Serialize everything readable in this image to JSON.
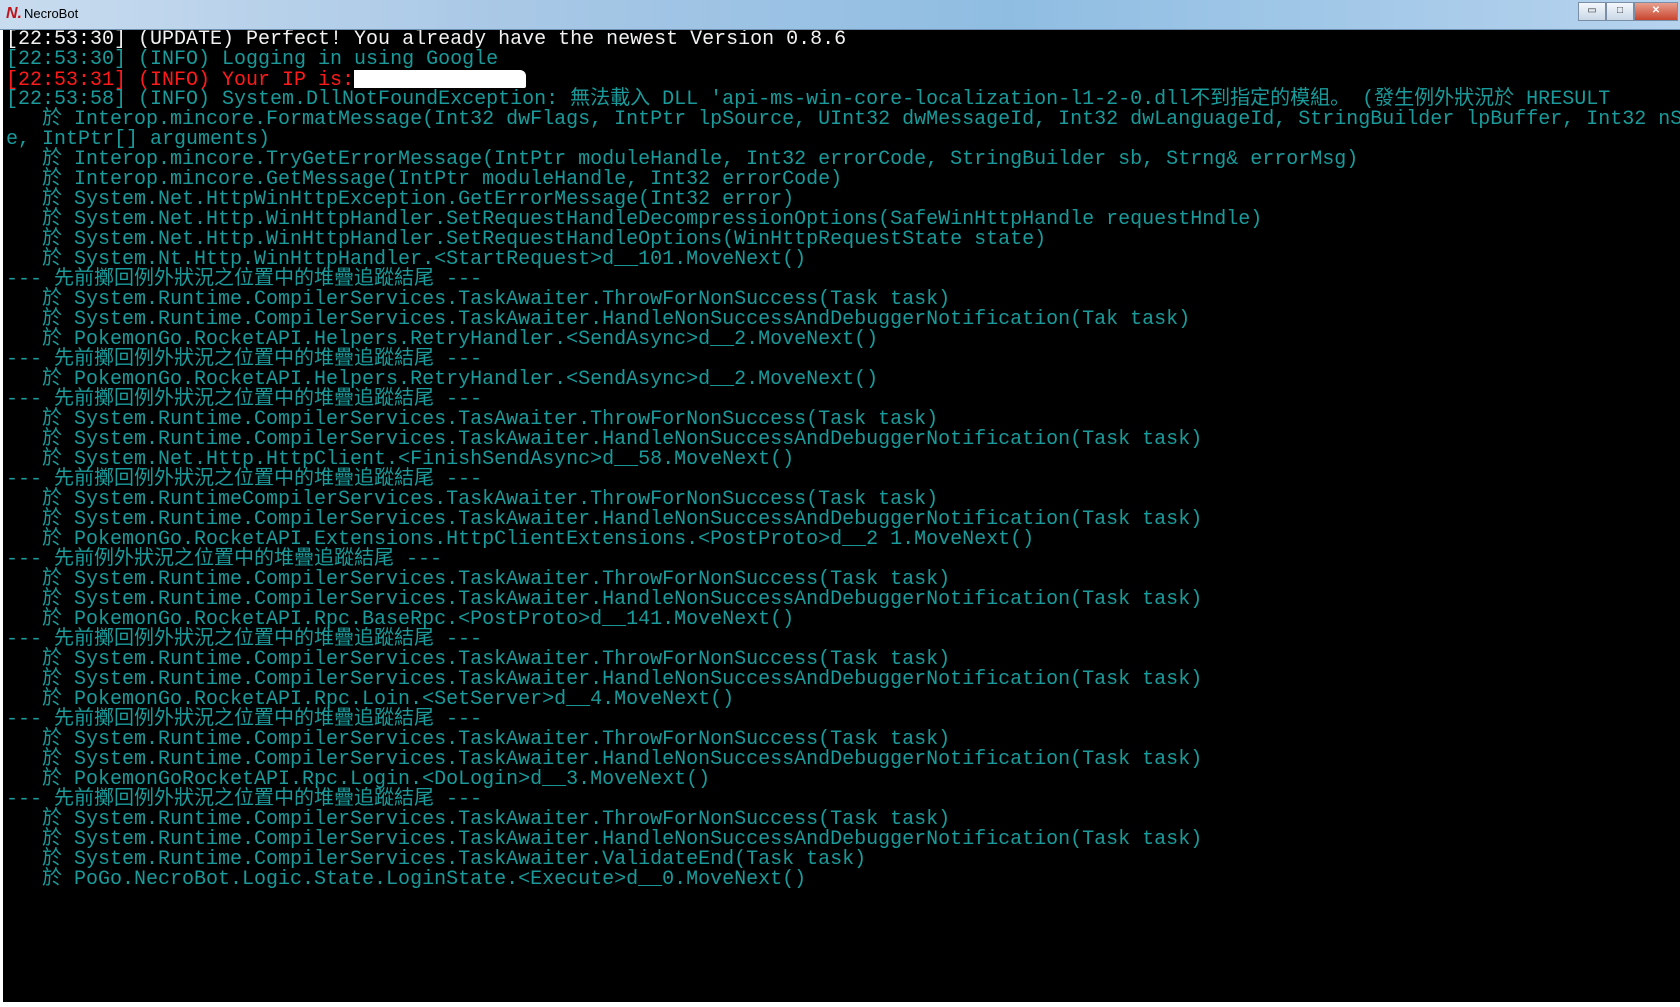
{
  "window": {
    "title": "NecroBot",
    "logo_text": "N.",
    "buttons": {
      "minimize": "▭",
      "maximize": "□",
      "close": "✕"
    }
  },
  "colors": {
    "white": "#f2f2f2",
    "teal": "#1a9a9a",
    "red": "#ff1a1a"
  },
  "lines": [
    {
      "color": "white",
      "text": "[22:53:30] (UPDATE) Perfect! You already have the newest Version 0.8.6"
    },
    {
      "color": "teal",
      "text": "[22:53:30] (INFO) Logging in using Google"
    },
    {
      "color": "red",
      "text": "[22:53:31] (INFO) Your IP is:",
      "redacted": true
    },
    {
      "color": "teal",
      "text": "[22:53:58] (INFO) System.DllNotFoundException: 無法載入 DLL 'api-ms-win-core-localization-l1-2-0.dll不到指定的模組。 (發生例外狀況於 HRESULT"
    },
    {
      "color": "teal",
      "text": "   於 Interop.mincore.FormatMessage(Int32 dwFlags, IntPtr lpSource, UInt32 dwMessageId, Int32 dwLanguageId, StringBuilder lpBuffer, Int32 nS"
    },
    {
      "color": "teal",
      "text": "e, IntPtr[] arguments)"
    },
    {
      "color": "teal",
      "text": "   於 Interop.mincore.TryGetErrorMessage(IntPtr moduleHandle, Int32 errorCode, StringBuilder sb, Strng& errorMsg)"
    },
    {
      "color": "teal",
      "text": "   於 Interop.mincore.GetMessage(IntPtr moduleHandle, Int32 errorCode)"
    },
    {
      "color": "teal",
      "text": "   於 System.Net.HttpWinHttpException.GetErrorMessage(Int32 error)"
    },
    {
      "color": "teal",
      "text": "   於 System.Net.Http.WinHttpHandler.SetRequestHandleDecompressionOptions(SafeWinHttpHandle requestHndle)"
    },
    {
      "color": "teal",
      "text": "   於 System.Net.Http.WinHttpHandler.SetRequestHandleOptions(WinHttpRequestState state)"
    },
    {
      "color": "teal",
      "text": "   於 System.Nt.Http.WinHttpHandler.<StartRequest>d__101.MoveNext()"
    },
    {
      "color": "teal",
      "text": "--- 先前擲回例外狀況之位置中的堆疊追蹤結尾 ---"
    },
    {
      "color": "teal",
      "text": "   於 System.Runtime.CompilerServices.TaskAwaiter.ThrowForNonSuccess(Task task)"
    },
    {
      "color": "teal",
      "text": "   於 System.Runtime.CompilerServices.TaskAwaiter.HandleNonSuccessAndDebuggerNotification(Tak task)"
    },
    {
      "color": "teal",
      "text": "   於 PokemonGo.RocketAPI.Helpers.RetryHandler.<SendAsync>d__2.MoveNext()"
    },
    {
      "color": "teal",
      "text": "--- 先前擲回例外狀況之位置中的堆疊追蹤結尾 ---"
    },
    {
      "color": "teal",
      "text": "   於 PokemonGo.RocketAPI.Helpers.RetryHandler.<SendAsync>d__2.MoveNext()"
    },
    {
      "color": "teal",
      "text": "--- 先前擲回例外狀況之位置中的堆疊追蹤結尾 ---"
    },
    {
      "color": "teal",
      "text": "   於 System.Runtime.CompilerServices.TasAwaiter.ThrowForNonSuccess(Task task)"
    },
    {
      "color": "teal",
      "text": "   於 System.Runtime.CompilerServices.TaskAwaiter.HandleNonSuccessAndDebuggerNotification(Task task)"
    },
    {
      "color": "teal",
      "text": "   於 System.Net.Http.HttpClient.<FinishSendAsync>d__58.MoveNext()"
    },
    {
      "color": "teal",
      "text": "--- 先前擲回例外狀況之位置中的堆疊追蹤結尾 ---"
    },
    {
      "color": "teal",
      "text": "   於 System.RuntimeCompilerServices.TaskAwaiter.ThrowForNonSuccess(Task task)"
    },
    {
      "color": "teal",
      "text": "   於 System.Runtime.CompilerServices.TaskAwaiter.HandleNonSuccessAndDebuggerNotification(Task task)"
    },
    {
      "color": "teal",
      "text": "   於 PokemonGo.RocketAPI.Extensions.HttpClientExtensions.<PostProto>d__2 1.MoveNext()"
    },
    {
      "color": "teal",
      "text": "--- 先前例外狀況之位置中的堆疊追蹤結尾 ---"
    },
    {
      "color": "teal",
      "text": "   於 System.Runtime.CompilerServices.TaskAwaiter.ThrowForNonSuccess(Task task)"
    },
    {
      "color": "teal",
      "text": "   於 System.Runtime.CompilerServices.TaskAwaiter.HandleNonSuccessAndDebuggerNotification(Task task)"
    },
    {
      "color": "teal",
      "text": "   於 PokemonGo.RocketAPI.Rpc.BaseRpc.<PostProto>d__141.MoveNext()"
    },
    {
      "color": "teal",
      "text": "--- 先前擲回例外狀況之位置中的堆疊追蹤結尾 ---"
    },
    {
      "color": "teal",
      "text": "   於 System.Runtime.CompilerServices.TaskAwaiter.ThrowForNonSuccess(Task task)"
    },
    {
      "color": "teal",
      "text": "   於 System.Runtime.CompilerServices.TaskAwaiter.HandleNonSuccessAndDebuggerNotification(Task task)"
    },
    {
      "color": "teal",
      "text": "   於 PokemonGo.RocketAPI.Rpc.Loin.<SetServer>d__4.MoveNext()"
    },
    {
      "color": "teal",
      "text": "--- 先前擲回例外狀況之位置中的堆疊追蹤結尾 ---"
    },
    {
      "color": "teal",
      "text": "   於 System.Runtime.CompilerServices.TaskAwaiter.ThrowForNonSuccess(Task task)"
    },
    {
      "color": "teal",
      "text": "   於 System.Runtime.CompilerServices.TaskAwaiter.HandleNonSuccessAndDebuggerNotification(Task task)"
    },
    {
      "color": "teal",
      "text": "   於 PokemonGoRocketAPI.Rpc.Login.<DoLogin>d__3.MoveNext()"
    },
    {
      "color": "teal",
      "text": "--- 先前擲回例外狀況之位置中的堆疊追蹤結尾 ---"
    },
    {
      "color": "teal",
      "text": "   於 System.Runtime.CompilerServices.TaskAwaiter.ThrowForNonSuccess(Task task)"
    },
    {
      "color": "teal",
      "text": "   於 System.Runtime.CompilerServices.TaskAwaiter.HandleNonSuccessAndDebuggerNotification(Task task)"
    },
    {
      "color": "teal",
      "text": "   於 System.Runtime.CompilerServices.TaskAwaiter.ValidateEnd(Task task)"
    },
    {
      "color": "teal",
      "text": "   於 PoGo.NecroBot.Logic.State.LoginState.<Execute>d__0.MoveNext()"
    }
  ]
}
